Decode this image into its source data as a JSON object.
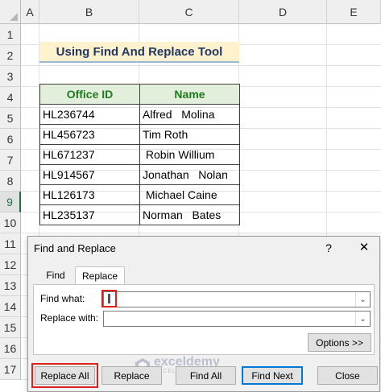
{
  "sheet": {
    "columns": [
      "A",
      "B",
      "C",
      "D",
      "E"
    ],
    "rows": [
      "1",
      "2",
      "3",
      "4",
      "5",
      "6",
      "7",
      "8",
      "9",
      "10",
      "11",
      "12",
      "13",
      "14",
      "15",
      "16",
      "17"
    ],
    "selected_row": "9",
    "title": "Using Find And Replace Tool",
    "table": {
      "headers": [
        "Office ID",
        "Name"
      ],
      "rows": [
        [
          "HL236744",
          "Alfred   Molina"
        ],
        [
          "HL456723",
          "Tim Roth"
        ],
        [
          "HL671237",
          " Robin Willium"
        ],
        [
          "HL914567",
          "Jonathan   Nolan"
        ],
        [
          "HL126173",
          " Michael Caine"
        ],
        [
          "HL235137",
          "Norman   Bates"
        ]
      ]
    }
  },
  "dialog": {
    "title": "Find and Replace",
    "help_label": "?",
    "close_label": "✕",
    "tabs": [
      "Find",
      "Replace"
    ],
    "active_tab": "Replace",
    "find_what_label": "Find what:",
    "find_what_value": "",
    "replace_with_label": "Replace with:",
    "replace_with_value": "",
    "buttons": {
      "options": "Options >>",
      "replace_all": "Replace All",
      "replace": "Replace",
      "find_all": "Find All",
      "find_next": "Find Next",
      "close": "Close"
    }
  },
  "watermark": {
    "name": "exceldemy",
    "subtitle": "EXCEL · DATA · BI"
  }
}
